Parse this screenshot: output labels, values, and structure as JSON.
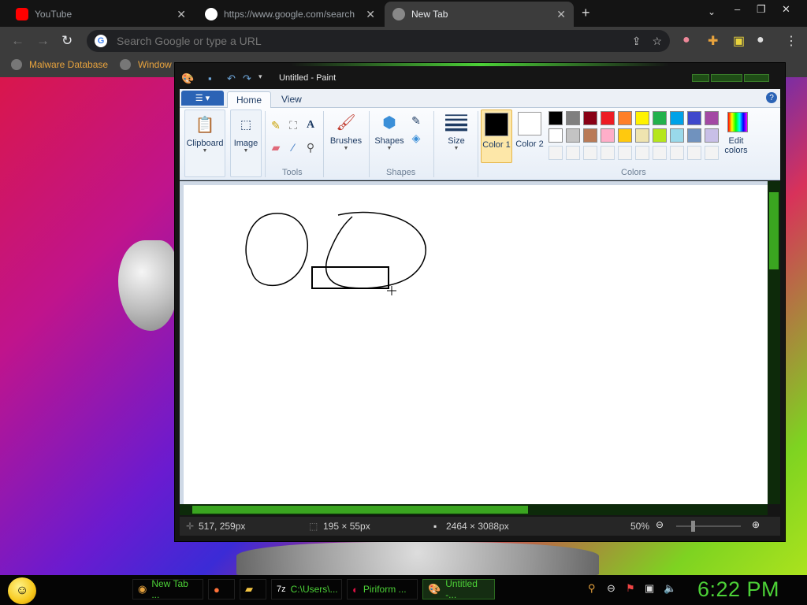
{
  "browser": {
    "tabs": [
      {
        "title": "YouTube",
        "favicon": "youtube-icon",
        "color": "#ff0000"
      },
      {
        "title": "https://www.google.com/search",
        "favicon": "google-icon",
        "color": "#ffffff"
      },
      {
        "title": "New Tab",
        "favicon": "chrome-icon",
        "color": "#888888"
      }
    ],
    "omnibox_placeholder": "Search Google or type a URL",
    "bookmarks": [
      {
        "label": "Malware Database"
      },
      {
        "label": "Window"
      }
    ]
  },
  "paint": {
    "title": "Untitled - Paint",
    "tabs": [
      "Home",
      "View"
    ],
    "groups": {
      "clipboard": "Clipboard",
      "image": "Image",
      "tools": "Tools",
      "brushes": "Brushes",
      "shapes_btn": "Shapes",
      "shapes_group": "Shapes",
      "size": "Size",
      "color1": "Color 1",
      "color2": "Color 2",
      "colors": "Colors",
      "edit_colors": "Edit colors"
    },
    "color1": "#000000",
    "color2": "#ffffff",
    "palette": [
      "#000000",
      "#7f7f7f",
      "#880015",
      "#ed1c24",
      "#ff7f27",
      "#fff200",
      "#22b14c",
      "#00a2e8",
      "#3f48cc",
      "#a349a4",
      "#ffffff",
      "#c3c3c3",
      "#b97a57",
      "#ffaec9",
      "#ffc90e",
      "#efe4b0",
      "#b5e61d",
      "#99d9ea",
      "#7092be",
      "#c8bfe7",
      "#f3f3f3",
      "#f3f3f3",
      "#f3f3f3",
      "#f3f3f3",
      "#f3f3f3",
      "#f3f3f3",
      "#f3f3f3",
      "#f3f3f3",
      "#f3f3f3",
      "#f3f3f3"
    ],
    "status": {
      "cursor": "517, 259px",
      "selection": "195 × 55px",
      "image_size": "2464 × 3088px",
      "zoom": "50%"
    }
  },
  "taskbar": {
    "items": [
      {
        "label": "New Tab ...",
        "icon": "chrome-icon"
      },
      {
        "label": "",
        "icon": "firefox-icon"
      },
      {
        "label": "",
        "icon": "folder-icon"
      },
      {
        "label": "C:\\Users\\...",
        "icon": "7zip-icon"
      },
      {
        "label": "Piriform ...",
        "icon": "ccleaner-icon"
      },
      {
        "label": "Untitled -...",
        "icon": "paint-icon"
      }
    ],
    "clock": "6:22 PM"
  }
}
